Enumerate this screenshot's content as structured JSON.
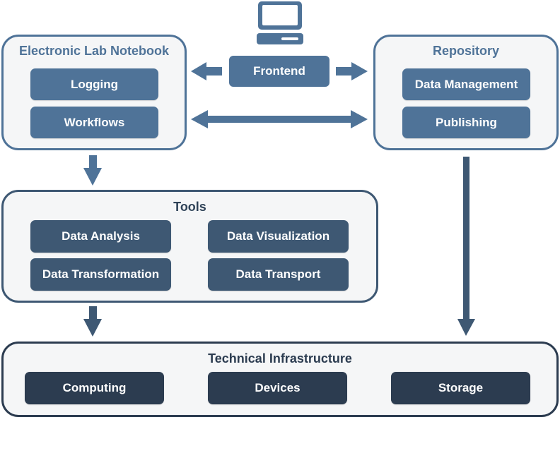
{
  "colors": {
    "top_tier": "#4f7398",
    "middle_tier": "#3e5873",
    "bottom_tier": "#2c3c50",
    "group_fill": "#f5f6f7"
  },
  "frontend": {
    "label": "Frontend",
    "icon": "computer-monitor-icon"
  },
  "eln": {
    "title": "Electronic Lab Notebook",
    "items": [
      {
        "label": "Logging"
      },
      {
        "label": "Workflows"
      }
    ]
  },
  "repository": {
    "title": "Repository",
    "items": [
      {
        "label": "Data Management"
      },
      {
        "label": "Publishing"
      }
    ]
  },
  "tools": {
    "title": "Tools",
    "items": [
      {
        "label": "Data Analysis"
      },
      {
        "label": "Data Visualization"
      },
      {
        "label": "Data Transformation"
      },
      {
        "label": "Data Transport"
      }
    ]
  },
  "infrastructure": {
    "title": "Technical Infrastructure",
    "items": [
      {
        "label": "Computing"
      },
      {
        "label": "Devices"
      },
      {
        "label": "Storage"
      }
    ]
  },
  "connections": [
    {
      "from": "Frontend",
      "to": "Electronic Lab Notebook",
      "direction": "one-way"
    },
    {
      "from": "Frontend",
      "to": "Repository",
      "direction": "one-way"
    },
    {
      "from": "Electronic Lab Notebook",
      "to": "Repository",
      "direction": "bidirectional"
    },
    {
      "from": "Electronic Lab Notebook",
      "to": "Tools",
      "direction": "one-way"
    },
    {
      "from": "Tools",
      "to": "Technical Infrastructure",
      "direction": "one-way"
    },
    {
      "from": "Repository",
      "to": "Technical Infrastructure",
      "direction": "one-way"
    }
  ]
}
